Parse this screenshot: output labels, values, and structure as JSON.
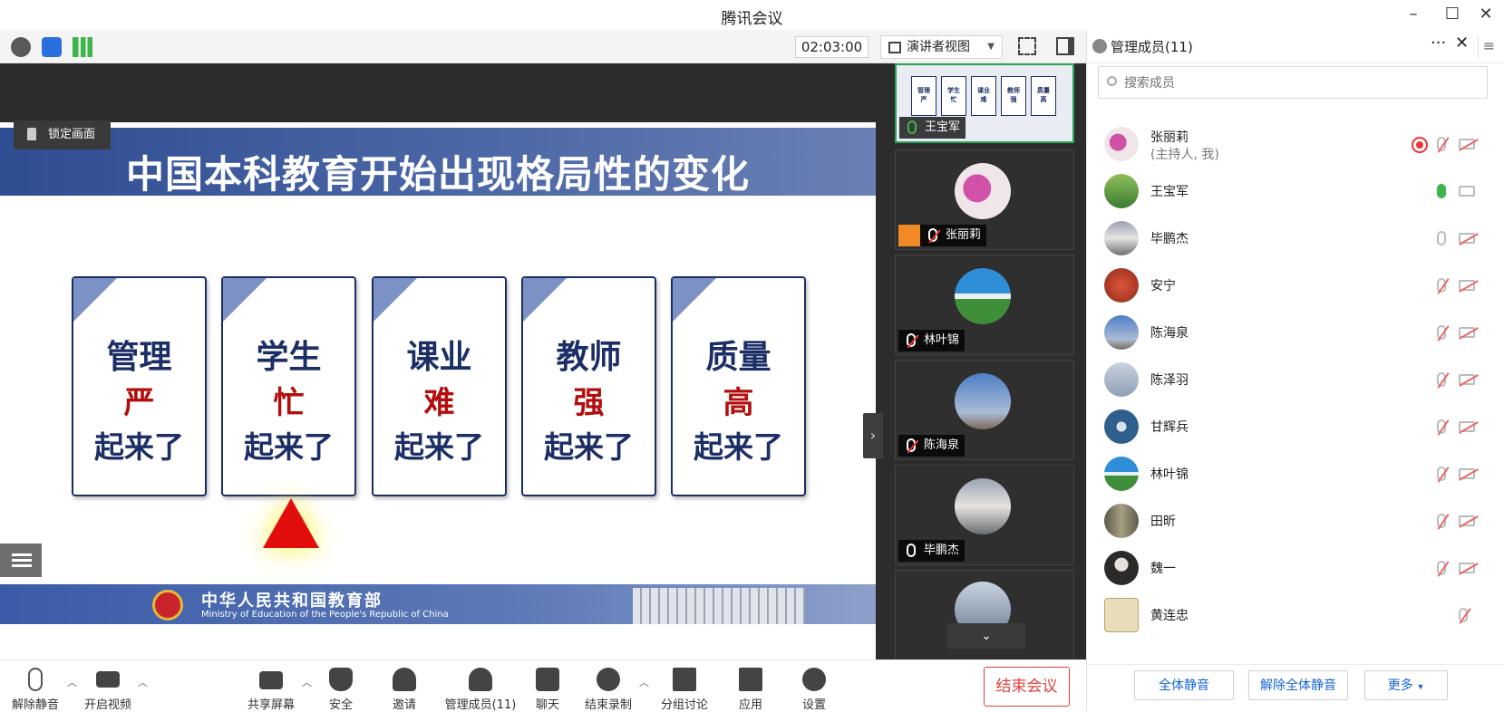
{
  "window": {
    "title": "腾讯会议"
  },
  "toolbar": {
    "timer": "02:03:00",
    "view_mode": "演讲者视图"
  },
  "slide": {
    "title": "中国本科教育开始出现格局性的变化",
    "lock_label": "锁定画面",
    "cards": [
      {
        "line1": "管理",
        "line2": "严",
        "line3": "起来了"
      },
      {
        "line1": "学生",
        "line2": "忙",
        "line3": "起来了"
      },
      {
        "line1": "课业",
        "line2": "难",
        "line3": "起来了"
      },
      {
        "line1": "教师",
        "line2": "强",
        "line3": "起来了"
      },
      {
        "line1": "质量",
        "line2": "高",
        "line3": "起来了"
      }
    ],
    "footer_cn": "中华人民共和国教育部",
    "footer_en": "Ministry of Education of the People's Republic of China"
  },
  "video_tiles": [
    {
      "name": "王宝军",
      "mic": "on",
      "avatar_color": "#e9ecf3"
    },
    {
      "name": "张丽莉",
      "mic": "muted",
      "host": true,
      "avatar_color": "#c2479c"
    },
    {
      "name": "林叶锦",
      "mic": "muted",
      "avatar_color": "#3f8e3a"
    },
    {
      "name": "陈海泉",
      "mic": "muted",
      "avatar_color": "#7b8fb6"
    },
    {
      "name": "毕鹏杰",
      "mic": "on",
      "avatar_color": "#8a8f99"
    }
  ],
  "panel": {
    "title": "管理成员(11)",
    "search_placeholder": "搜索成员",
    "members": [
      {
        "name": "张丽莉",
        "sub": "(主持人, 我)",
        "mic": "muted",
        "cam": "muted",
        "recording": true,
        "avatar_color": "#c2479c"
      },
      {
        "name": "王宝军",
        "sub": "",
        "mic": "on",
        "cam": "off",
        "avatar_color": "#5b8f3a"
      },
      {
        "name": "毕鹏杰",
        "sub": "",
        "mic": "off",
        "cam": "muted",
        "avatar_color": "#6f7784"
      },
      {
        "name": "安宁",
        "sub": "",
        "mic": "muted",
        "cam": "muted",
        "avatar_color": "#c0422a"
      },
      {
        "name": "陈海泉",
        "sub": "",
        "mic": "muted",
        "cam": "muted",
        "avatar_color": "#7b8fb6"
      },
      {
        "name": "陈泽羽",
        "sub": "",
        "mic": "muted",
        "cam": "muted",
        "avatar_color": "#9aa9bd"
      },
      {
        "name": "甘辉兵",
        "sub": "",
        "mic": "muted",
        "cam": "muted",
        "avatar_color": "#3a6e9a"
      },
      {
        "name": "林叶锦",
        "sub": "",
        "mic": "muted",
        "cam": "muted",
        "avatar_color": "#3f8e3a"
      },
      {
        "name": "田昕",
        "sub": "",
        "mic": "muted",
        "cam": "muted",
        "avatar_color": "#7c7560"
      },
      {
        "name": "魏一",
        "sub": "",
        "mic": "muted",
        "cam": "muted",
        "avatar_color": "#3c3c3c"
      },
      {
        "name": "黄连忠",
        "sub": "",
        "mic": "muted",
        "cam": "none",
        "avatar_color": "#d9cfa8"
      }
    ],
    "buttons": {
      "mute_all": "全体静音",
      "unmute_all": "解除全体静音",
      "more": "更多"
    }
  },
  "bottombar": {
    "unmute": "解除静音",
    "start_video": "开启视频",
    "share_screen": "共享屏幕",
    "security": "安全",
    "invite": "邀请",
    "manage_members": "管理成员(11)",
    "chat": "聊天",
    "stop_recording": "结束录制",
    "breakout": "分组讨论",
    "apps": "应用",
    "settings": "设置",
    "end_meeting": "结束会议"
  },
  "colors": {
    "accent": "#1664d9",
    "danger": "#e23d3d",
    "slide_blue": "#2f4d92",
    "mic_on": "#3cb54a"
  }
}
